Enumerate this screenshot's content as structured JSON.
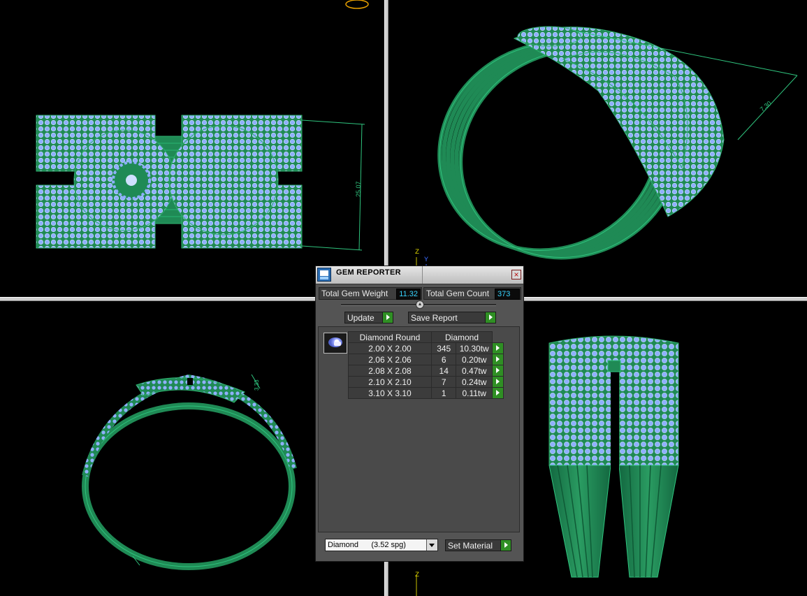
{
  "viewports": {
    "axis_z": "Z",
    "axis_y": "Y",
    "dimension_front": "25.07",
    "dimension_persp": "7.30",
    "dimension_side": "3.33"
  },
  "gem_reporter": {
    "title": "GEM REPORTER",
    "total_gem_weight_label": "Total Gem Weight",
    "total_gem_weight_value": "11.32",
    "total_gem_count_label": "Total Gem Count",
    "total_gem_count_value": "373",
    "update_label": "Update",
    "save_report_label": "Save Report",
    "table": {
      "header_shape": "Diamond Round",
      "header_material": "Diamond",
      "rows": [
        {
          "size": "2.00 X 2.00",
          "count": "345",
          "weight": "10.30tw"
        },
        {
          "size": "2.06 X 2.06",
          "count": "6",
          "weight": "0.20tw"
        },
        {
          "size": "2.08 X 2.08",
          "count": "14",
          "weight": "0.47tw"
        },
        {
          "size": "2.10 X 2.10",
          "count": "7",
          "weight": "0.24tw"
        },
        {
          "size": "3.10 X 3.10",
          "count": "1",
          "weight": "0.11tw"
        }
      ]
    },
    "material_select_value": "Diamond      (3.52 spg)",
    "set_material_label": "Set Material"
  },
  "colors": {
    "metal": "#1f8a55",
    "gem": "#8fb0ff",
    "accent_button": "#2f8f24"
  }
}
